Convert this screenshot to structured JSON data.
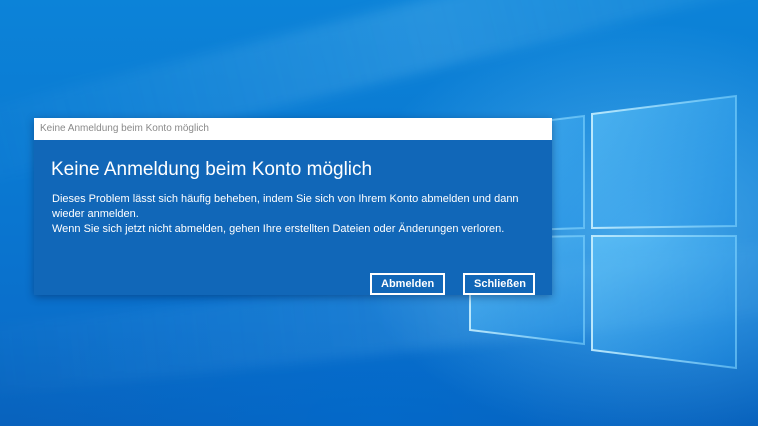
{
  "dialog": {
    "titlebar_text": "Keine Anmeldung beim Konto möglich",
    "heading": "Keine Anmeldung beim Konto möglich",
    "message_line1": "Dieses Problem lässt sich häufig beheben, indem Sie sich von Ihrem Konto abmelden und dann wieder anmelden.",
    "message_line2": "Wenn Sie sich jetzt nicht abmelden, gehen Ihre erstellten Dateien oder Änderungen verloren.",
    "buttons": {
      "sign_out_label": "Abmelden",
      "close_label": "Schließen"
    }
  },
  "colors": {
    "dialog_body": "#1167b8",
    "titlebar": "#ffffff",
    "titlebar_text": "#8a8a8a",
    "desktop": "#0a79d2"
  },
  "icons": {
    "desktop_logo": "windows-logo-icon"
  }
}
